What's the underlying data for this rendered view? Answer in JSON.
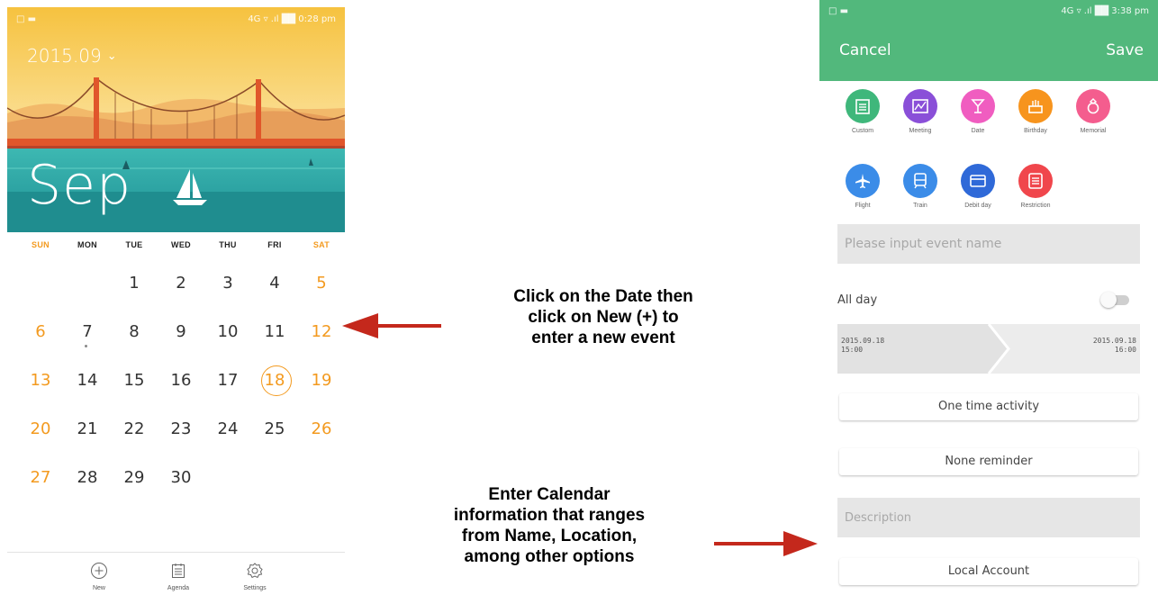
{
  "calendar": {
    "status_left": "□ ▬",
    "status_right": "4G ▿ .ıl ██ 0:28 pm",
    "month_picker": "2015.09",
    "month_big": "Sep",
    "weekdays": [
      "SUN",
      "MON",
      "TUE",
      "WED",
      "THU",
      "FRI",
      "SAT"
    ],
    "days": [
      "1",
      "2",
      "3",
      "4",
      "5",
      "6",
      "7",
      "8",
      "9",
      "10",
      "11",
      "12",
      "13",
      "14",
      "15",
      "16",
      "17",
      "18",
      "19",
      "20",
      "21",
      "22",
      "23",
      "24",
      "25",
      "26",
      "27",
      "28",
      "29",
      "30"
    ],
    "today": "18",
    "event_day": "7",
    "tabs": [
      {
        "label": "New",
        "icon": "plus-circle-icon"
      },
      {
        "label": "Agenda",
        "icon": "agenda-icon"
      },
      {
        "label": "Settings",
        "icon": "gear-icon"
      }
    ]
  },
  "annotations": {
    "date_note": [
      "Click on the Date then",
      "click on New (+) to",
      "enter a new event"
    ],
    "info_note": [
      "Enter Calendar",
      "information that ranges",
      "from Name, Location,",
      "among other options"
    ],
    "arrow_color": "#c4281c"
  },
  "event_form": {
    "status_left": "□ ▬",
    "status_right": "4G ▿ .ıl ██ 3:38 pm",
    "cancel": "Cancel",
    "save": "Save",
    "header_color": "#52b87c",
    "categories": [
      {
        "label": "Custom",
        "color": "#3fb77b",
        "icon": "calendar-icon"
      },
      {
        "label": "Meeting",
        "color": "#8a4fd8",
        "icon": "chart-icon"
      },
      {
        "label": "Date",
        "color": "#f05dc0",
        "icon": "glass-icon"
      },
      {
        "label": "Birthday",
        "color": "#f7941d",
        "icon": "cake-icon"
      },
      {
        "label": "Memorial",
        "color": "#f45d8e",
        "icon": "ring-icon"
      },
      {
        "label": "Flight",
        "color": "#3b8ce8",
        "icon": "plane-icon"
      },
      {
        "label": "Train",
        "color": "#3b8ce8",
        "icon": "train-icon"
      },
      {
        "label": "Debit day",
        "color": "#2f69d8",
        "icon": "card-icon"
      },
      {
        "label": "Restriction",
        "color": "#f0464c",
        "icon": "restriction-icon"
      }
    ],
    "event_name_placeholder": "Please input event name",
    "all_day": "All day",
    "start_date": "2015.09.18",
    "start_time": "15:00",
    "end_date": "2015.09.18",
    "end_time": "16:00",
    "repeat": "One time activity",
    "reminder": "None reminder",
    "description_placeholder": "Description",
    "account": "Local Account"
  }
}
